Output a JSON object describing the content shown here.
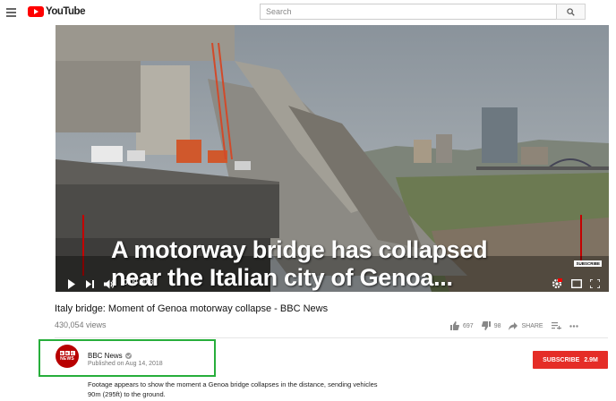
{
  "header": {
    "logo_text": "YouTube",
    "search": {
      "placeholder": "Search",
      "value": ""
    }
  },
  "player": {
    "caption_line1": "A motorway bridge has collapsed",
    "caption_line2": "near the Italian city of Genoa...",
    "badge": "SUBSCRIBE",
    "time": "0:09 / 0:31",
    "progress_fraction": 0.29
  },
  "video": {
    "title": "Italy bridge: Moment of Genoa motorway collapse - BBC News",
    "views": "430,054 views",
    "likes": "697",
    "dislikes": "98",
    "share_label": "SHARE"
  },
  "channel": {
    "name": "BBC News",
    "published": "Published on Aug 14, 2018",
    "avatar_letters": [
      "B",
      "B",
      "C"
    ],
    "avatar_word": "NEWS",
    "subscribe_label": "SUBSCRIBE",
    "subscriber_count": "2.9M",
    "description_line1": "Footage appears to show the moment a Genoa bridge collapses in the distance, sending vehicles",
    "description_line2": "90m (295ft) to the ground."
  },
  "colors": {
    "brand_red": "#ff0000",
    "subscribe_red": "#e52d27",
    "highlight_box": "#27ae3b",
    "bbc_red": "#b80000"
  }
}
